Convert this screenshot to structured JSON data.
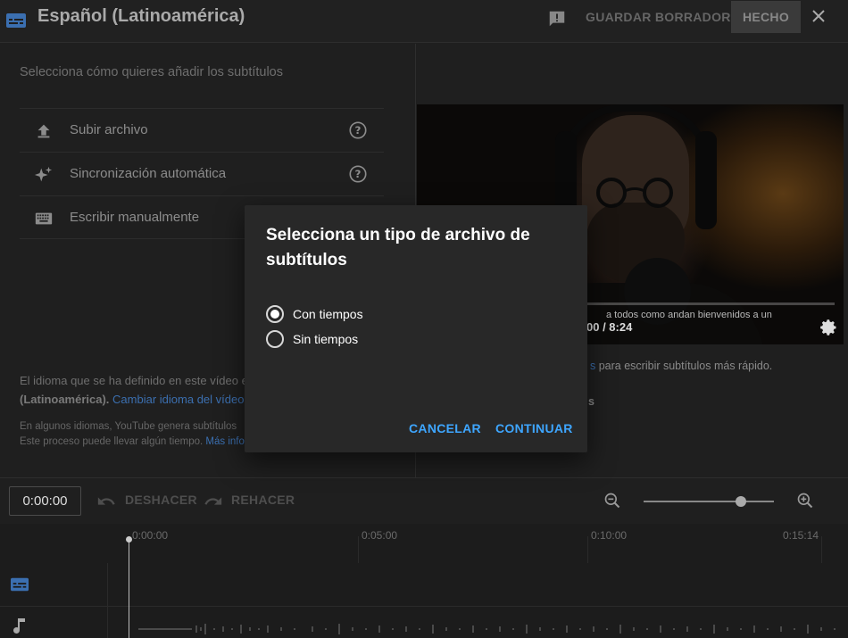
{
  "header": {
    "title": "Español (Latinoamérica)",
    "draft_label": "GUARDAR BORRADOR",
    "done_label": "HECHO"
  },
  "left_panel": {
    "prompt": "Selecciona cómo quieres añadir los subtítulos",
    "options": [
      {
        "label": "Subir archivo",
        "icon": "upload-icon",
        "has_help": true
      },
      {
        "label": "Sincronización automática",
        "icon": "sparkle-icon",
        "has_help": true
      },
      {
        "label": "Escribir manualmente",
        "icon": "keyboard-icon",
        "has_help": false
      }
    ],
    "info_line1": "El idioma que se ha definido en este vídeo es",
    "info_lang": "(Latinoamérica).",
    "info_link": "Cambiar idioma del vídeo",
    "info_small1": "En algunos idiomas, YouTube genera subtítulos",
    "info_small2": "Este proceso puede llevar algún tiempo.",
    "info_small_link": "Más información"
  },
  "right_panel": {
    "video_caption": "a todos como andan bienvenidos a un",
    "video_time": "00 / 8:24",
    "tip_link": "s",
    "tip_text": "para escribir subtítulos más rápido.",
    "tip2": "s"
  },
  "toolbar": {
    "current_time": "0:00:00",
    "undo_label": "DESHACER",
    "redo_label": "REHACER",
    "zoom_level": 0.71
  },
  "ruler": {
    "marks": [
      "0:00:00",
      "0:05:00",
      "0:10:00",
      "0:15:14"
    ]
  },
  "dialog": {
    "title": "Selecciona un tipo de archivo de subtítulos",
    "options": [
      {
        "label": "Con tiempos",
        "selected": true
      },
      {
        "label": "Sin tiempos",
        "selected": false
      }
    ],
    "cancel_label": "CANCELAR",
    "continue_label": "CONTINUAR"
  },
  "colors": {
    "accent": "#3ea6ff",
    "subtitle_icon": "#3b6fb0"
  }
}
